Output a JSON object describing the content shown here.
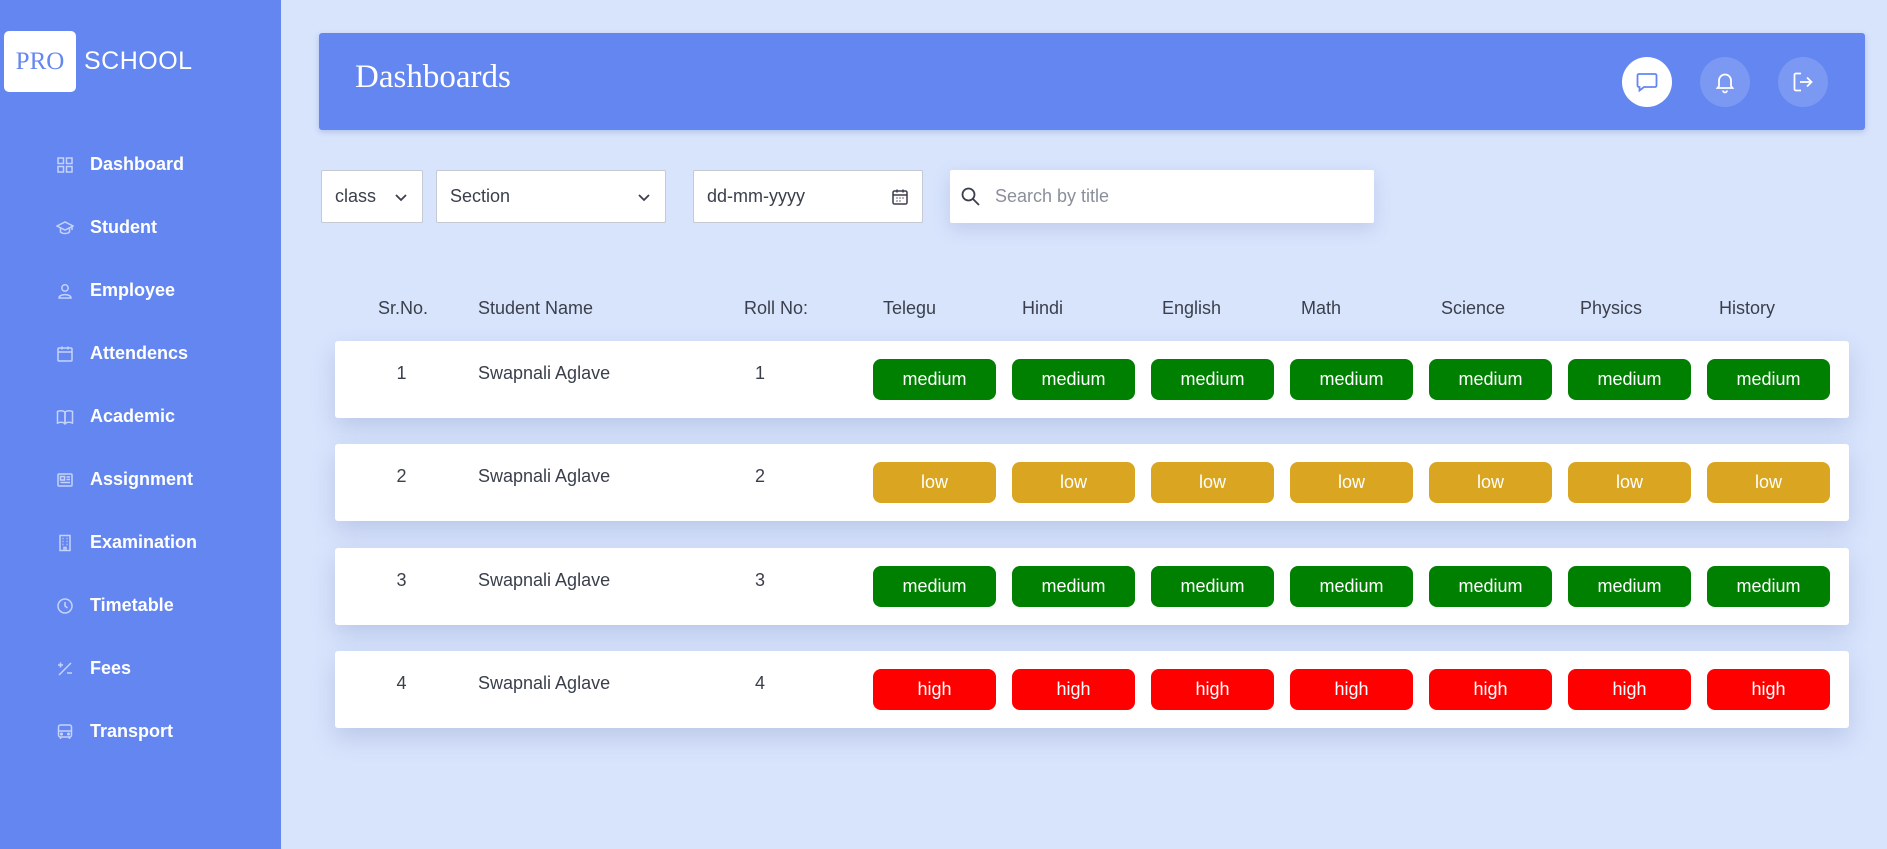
{
  "brand": {
    "pro": "PRO",
    "school": "SCHOOL"
  },
  "sidebar": {
    "items": [
      {
        "label": "Dashboard",
        "icon": "grid-icon"
      },
      {
        "label": "Student",
        "icon": "graduation-cap-icon"
      },
      {
        "label": "Employee",
        "icon": "user-icon"
      },
      {
        "label": "Attendencs",
        "icon": "calendar-icon"
      },
      {
        "label": "Academic",
        "icon": "book-open-icon"
      },
      {
        "label": "Assignment",
        "icon": "newspaper-icon"
      },
      {
        "label": "Examination",
        "icon": "building-icon"
      },
      {
        "label": "Timetable",
        "icon": "clock-icon"
      },
      {
        "label": "Fees",
        "icon": "percent-icon"
      },
      {
        "label": "Transport",
        "icon": "bus-icon"
      }
    ]
  },
  "header": {
    "title": "Dashboards",
    "icons": [
      "chat-icon",
      "bell-icon",
      "logout-icon"
    ]
  },
  "filters": {
    "class_value": "class",
    "section_value": "Section",
    "date_placeholder": "dd-mm-yyyy",
    "search_placeholder": "Search by title"
  },
  "table": {
    "headers": {
      "sr": "Sr.No.",
      "name": "Student Name",
      "roll": "Roll No:",
      "subjects": [
        "Telegu",
        "Hindi",
        "English",
        "Math",
        "Science",
        "Physics",
        "History"
      ]
    },
    "rows": [
      {
        "sr": "1",
        "name": "Swapnali Aglave",
        "roll": "1",
        "levels": [
          "medium",
          "medium",
          "medium",
          "medium",
          "medium",
          "medium",
          "medium"
        ]
      },
      {
        "sr": "2",
        "name": "Swapnali Aglave",
        "roll": "2",
        "levels": [
          "low",
          "low",
          "low",
          "low",
          "low",
          "low",
          "low"
        ]
      },
      {
        "sr": "3",
        "name": "Swapnali Aglave",
        "roll": "3",
        "levels": [
          "medium",
          "medium",
          "medium",
          "medium",
          "medium",
          "medium",
          "medium"
        ]
      },
      {
        "sr": "4",
        "name": "Swapnali Aglave",
        "roll": "4",
        "levels": [
          "high",
          "high",
          "high",
          "high",
          "high",
          "high",
          "high"
        ]
      }
    ]
  },
  "colors": {
    "primary": "#6486f0",
    "background": "#d8e4fc",
    "level_medium": "#008000",
    "level_low": "#daa520",
    "level_high": "#ff0000"
  }
}
